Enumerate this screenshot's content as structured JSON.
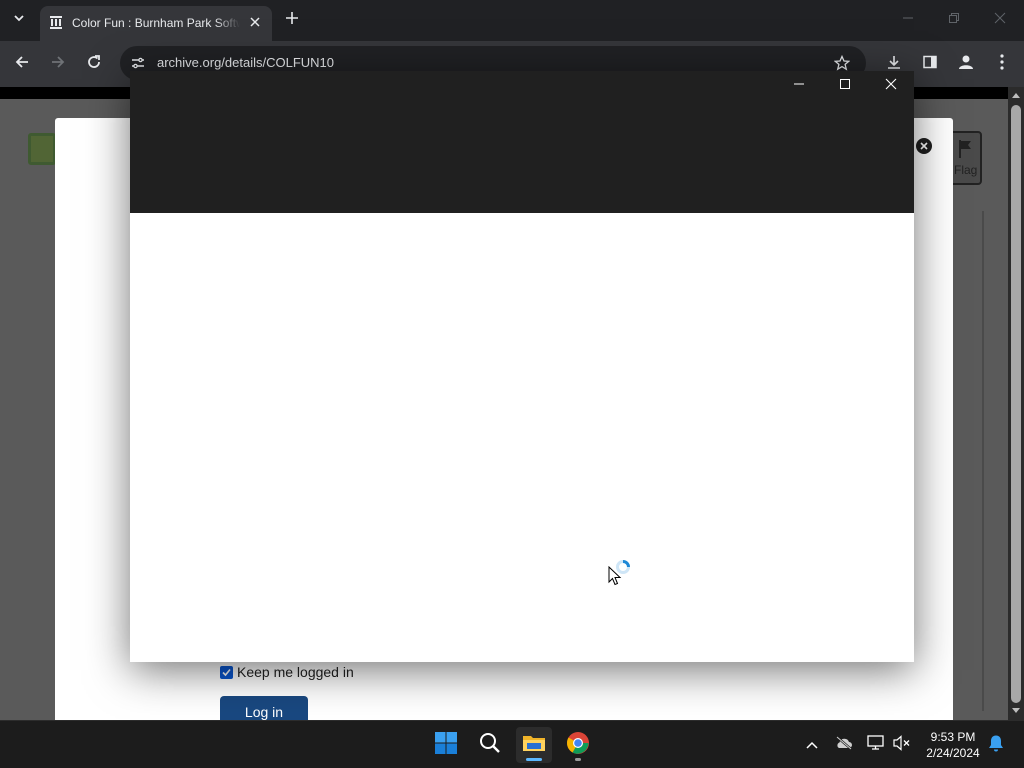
{
  "browser": {
    "tab": {
      "title": "Color Fun : Burnham Park Software"
    },
    "omnibox": {
      "url": "archive.org/details/COLFUN10"
    }
  },
  "page": {
    "flag_label": "Flag",
    "login": {
      "keep_logged_in_label": "Keep me logged in",
      "keep_logged_in_checked": true,
      "login_button": "Log in"
    }
  },
  "taskbar": {
    "apps": [
      "start",
      "search",
      "file-explorer",
      "chrome"
    ],
    "clock": {
      "time": "9:53 PM",
      "date": "2/24/2024"
    }
  },
  "colors": {
    "chrome_bg": "#202124",
    "toolbar_bg": "#35363a",
    "popup_titlebar": "#202020",
    "login_button": "#194880",
    "checkbox": "#0b57d0",
    "windows_accent": "#0078d4"
  }
}
